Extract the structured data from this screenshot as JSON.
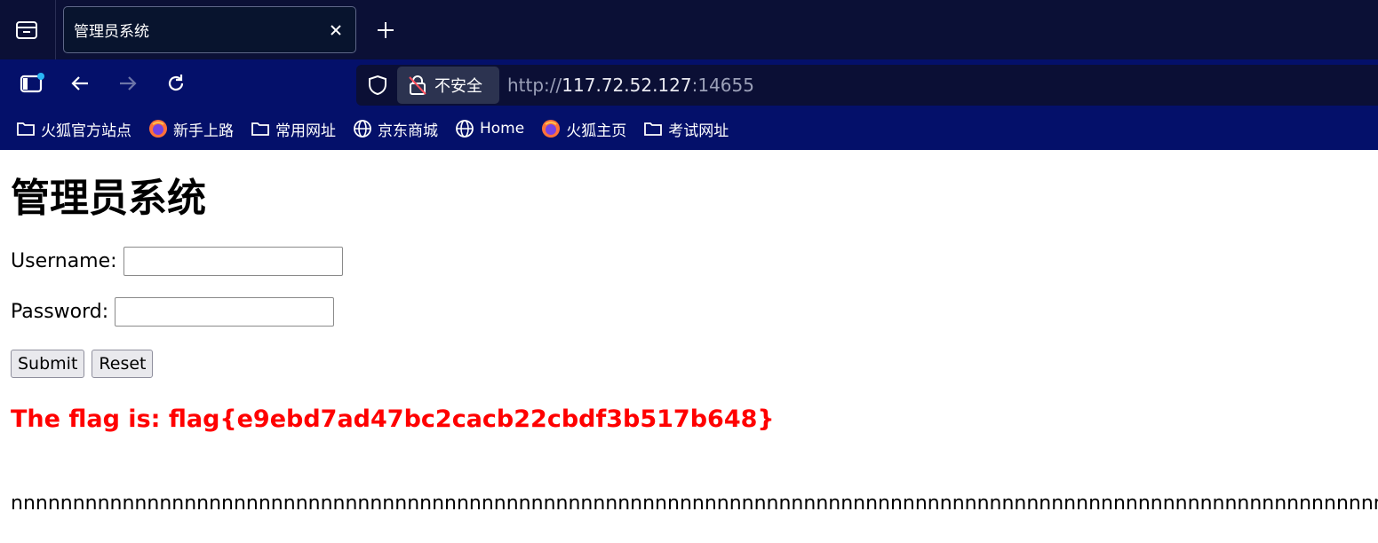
{
  "browser": {
    "tab": {
      "title": "管理员系统"
    },
    "address": {
      "security_label": "不安全",
      "url_scheme": "http://",
      "url_host": "117.72.52.127",
      "url_port": ":14655"
    },
    "bookmarks": [
      {
        "label": "火狐官方站点",
        "icon": "folder-icon"
      },
      {
        "label": "新手上路",
        "icon": "firefox-icon"
      },
      {
        "label": "常用网址",
        "icon": "folder-icon"
      },
      {
        "label": "京东商城",
        "icon": "globe-icon"
      },
      {
        "label": "Home",
        "icon": "globe-icon"
      },
      {
        "label": "火狐主页",
        "icon": "firefox-icon"
      },
      {
        "label": "考试网址",
        "icon": "folder-icon"
      }
    ]
  },
  "page": {
    "title": "管理员系统",
    "username_label": "Username:",
    "username_value": "",
    "password_label": "Password:",
    "password_value": "",
    "submit_label": "Submit",
    "reset_label": "Reset",
    "flag_text": "The flag is: flag{e9ebd7ad47bc2cacb22cbdf3b517b648}",
    "filler_text": "nnnnnnnnnnnnnnnnnnnnnnnnnnnnnnnnnnnnnnnnnnnnnnnnnnnnnnnnnnnnnnnnnnnnnnnnnnnnnnnnnnnnnnnnnnnnnnnnnnnnnnnnnnnnnnn"
  },
  "colors": {
    "tabbar_bg": "#0b1036",
    "toolbar_bg": "#04106a",
    "flag_color": "#ff0000"
  }
}
